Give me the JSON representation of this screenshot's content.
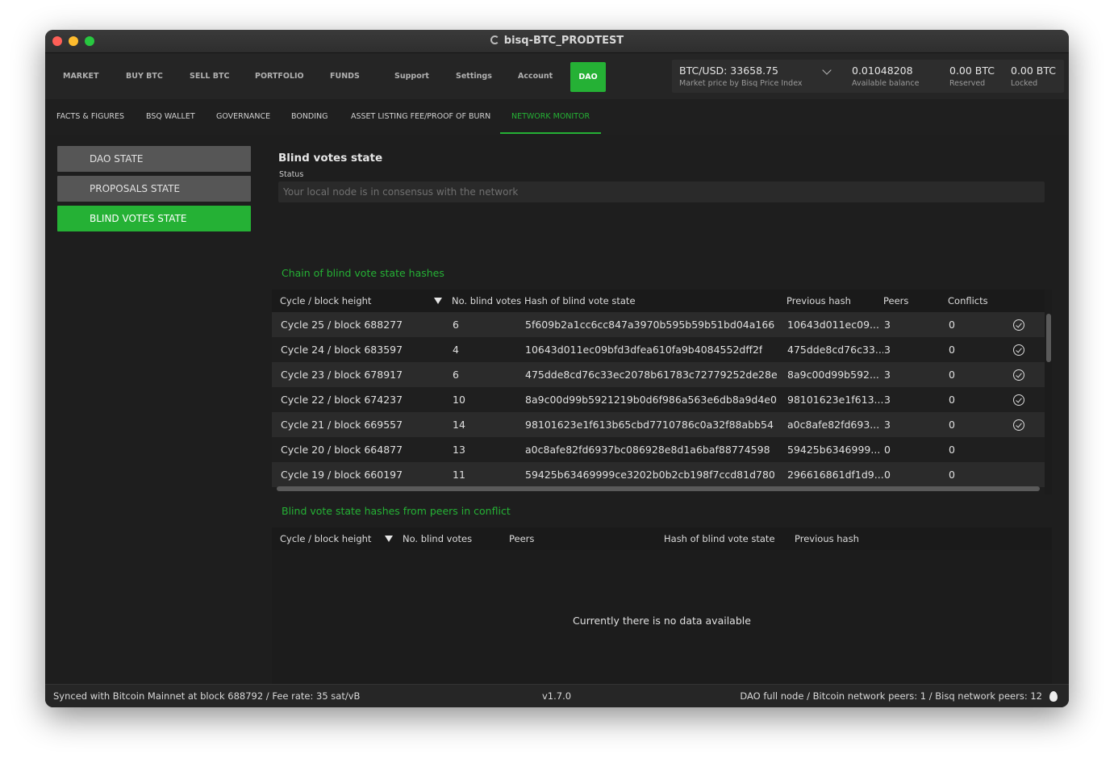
{
  "window": {
    "title": "bisq-BTC_PRODTEST"
  },
  "topnav": {
    "items": [
      "MARKET",
      "BUY BTC",
      "SELL BTC",
      "PORTFOLIO",
      "FUNDS",
      "Support",
      "Settings",
      "Account"
    ],
    "active": "DAO"
  },
  "balances": {
    "price": {
      "value": "BTC/USD: 33658.75",
      "label": "Market price by Bisq Price Index"
    },
    "available": {
      "value": "0.01048208",
      "label": "Available balance"
    },
    "reserved": {
      "value": "0.00 BTC",
      "label": "Reserved"
    },
    "locked": {
      "value": "0.00 BTC",
      "label": "Locked"
    }
  },
  "subnav": {
    "items": [
      "FACTS & FIGURES",
      "BSQ WALLET",
      "GOVERNANCE",
      "BONDING",
      "ASSET LISTING FEE/PROOF OF BURN",
      "NETWORK MONITOR"
    ],
    "active_index": 5
  },
  "sidebar": {
    "items": [
      "DAO STATE",
      "PROPOSALS STATE",
      "BLIND VOTES STATE"
    ],
    "active_index": 2
  },
  "main": {
    "heading": "Blind votes state",
    "status_label": "Status",
    "status_value": "Your local node is in consensus with the network",
    "chain_title": "Chain of blind vote state hashes",
    "conflict_title": "Blind vote state hashes from peers in conflict",
    "empty_message": "Currently there is no data available"
  },
  "chain_table": {
    "columns": [
      "Cycle / block height",
      "No. blind votes",
      "Hash of blind vote state",
      "Previous hash",
      "Peers",
      "Conflicts"
    ],
    "rows": [
      {
        "cycle": "Cycle 25 / block 688277",
        "votes": "6",
        "hash": "5f609b2a1cc6cc847a3970b595b59b51bd04a166",
        "prev": "10643d011ec09...",
        "peers": "3",
        "conflicts": "0",
        "ok": true
      },
      {
        "cycle": "Cycle 24 / block 683597",
        "votes": "4",
        "hash": "10643d011ec09bfd3dfea610fa9b4084552dff2f",
        "prev": "475dde8cd76c33...",
        "peers": "3",
        "conflicts": "0",
        "ok": true
      },
      {
        "cycle": "Cycle 23 / block 678917",
        "votes": "6",
        "hash": "475dde8cd76c33ec2078b61783c72779252de28e",
        "prev": "8a9c00d99b592...",
        "peers": "3",
        "conflicts": "0",
        "ok": true
      },
      {
        "cycle": "Cycle 22 / block 674237",
        "votes": "10",
        "hash": "8a9c00d99b5921219b0d6f986a563e6db8a9d4e0",
        "prev": "98101623e1f613...",
        "peers": "3",
        "conflicts": "0",
        "ok": true
      },
      {
        "cycle": "Cycle 21 / block 669557",
        "votes": "14",
        "hash": "98101623e1f613b65cbd7710786c0a32f88abb54",
        "prev": "a0c8afe82fd693...",
        "peers": "3",
        "conflicts": "0",
        "ok": true
      },
      {
        "cycle": "Cycle 20 / block 664877",
        "votes": "13",
        "hash": "a0c8afe82fd6937bc086928e8d1a6baf88774598",
        "prev": "59425b6346999...",
        "peers": "0",
        "conflicts": "0",
        "ok": false
      },
      {
        "cycle": "Cycle 19 / block 660197",
        "votes": "11",
        "hash": "59425b63469999ce3202b0b2cb198f7ccd81d780",
        "prev": "296616861df1d9...",
        "peers": "0",
        "conflicts": "0",
        "ok": false
      }
    ]
  },
  "conflict_table": {
    "columns": [
      "Cycle / block height",
      "No. blind votes",
      "Peers",
      "Hash of blind vote state",
      "Previous hash"
    ]
  },
  "statusbar": {
    "sync": "Synced with Bitcoin Mainnet at block 688792 / Fee rate: 35 sat/vB",
    "version": "v1.7.0",
    "network": "DAO full node / Bitcoin network peers: 1 / Bisq network peers: 12"
  }
}
